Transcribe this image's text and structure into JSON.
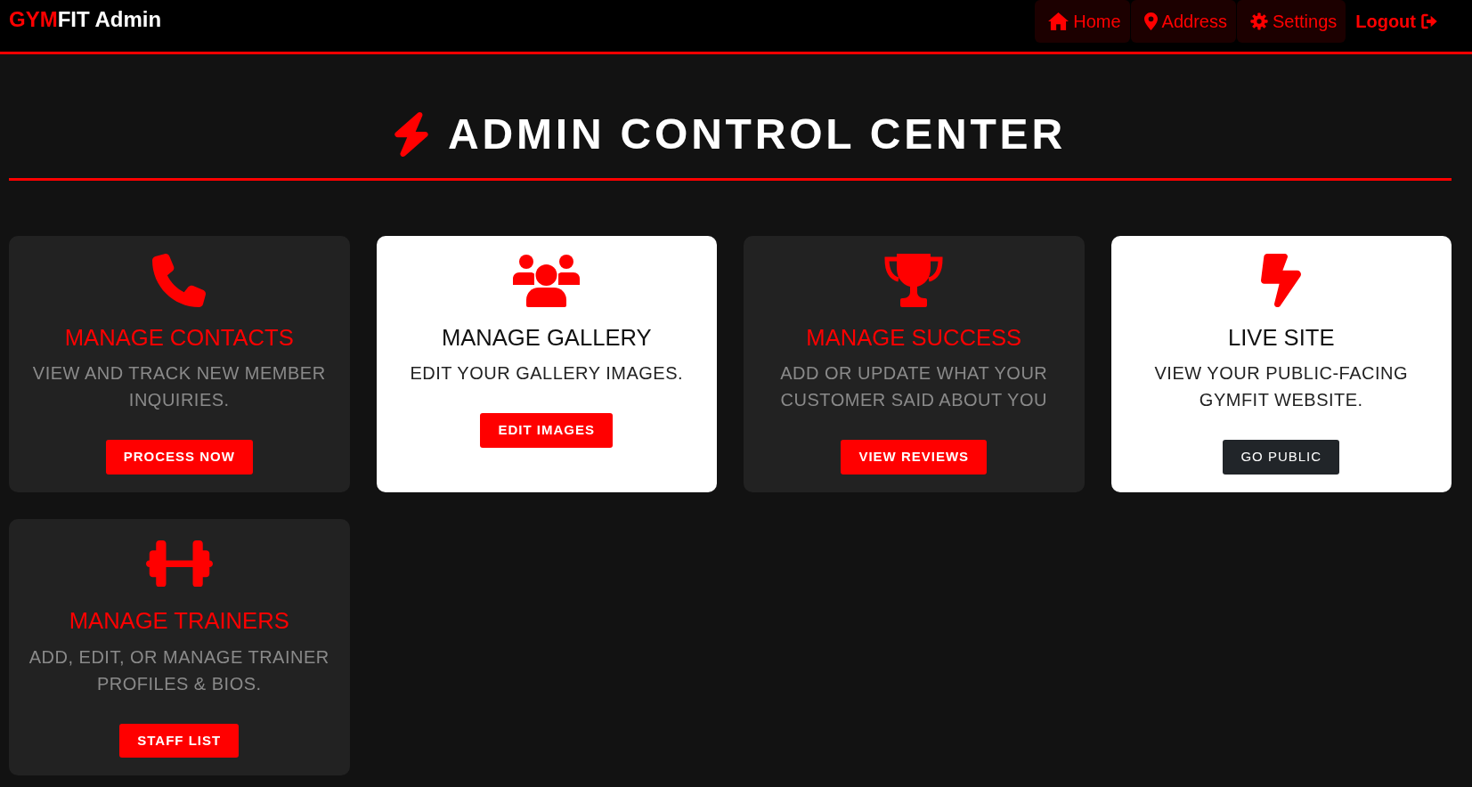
{
  "brand": {
    "accent": "GYM",
    "name": "FIT Admin"
  },
  "nav_links": [
    {
      "label": "Home",
      "kind": "tab"
    },
    {
      "label": "Address",
      "kind": "tab"
    },
    {
      "label": "Settings",
      "kind": "tab"
    },
    {
      "label": "Logout",
      "kind": "logout"
    }
  ],
  "header": {
    "title": "ADMIN CONTROL CENTER"
  },
  "cards": [
    {
      "kind": "dark",
      "title": "MANAGE CONTACTS",
      "description": "VIEW AND TRACK NEW MEMBER INQUIRIES.",
      "button": {
        "label": "PROCESS NOW",
        "kind": "primary"
      }
    },
    {
      "kind": "light",
      "title": "MANAGE GALLERY",
      "description": "EDIT YOUR GALLERY IMAGES.",
      "button": {
        "label": "EDIT IMAGES",
        "kind": "primary"
      }
    },
    {
      "kind": "dark",
      "title": "MANAGE SUCCESS",
      "description": "ADD OR UPDATE WHAT YOUR CUSTOMER SAID ABOUT YOU",
      "button": {
        "label": "VIEW REVIEWS",
        "kind": "primary"
      }
    },
    {
      "kind": "light",
      "title": "LIVE SITE",
      "description": "VIEW YOUR PUBLIC-FACING GYMFIT WEBSITE.",
      "button": {
        "label": "GO PUBLIC",
        "kind": "secondary"
      }
    },
    {
      "kind": "dark",
      "title": "MANAGE TRAINERS",
      "description": "ADD, EDIT, OR MANAGE TRAINER PROFILES & BIOS.",
      "button": {
        "label": "STAFF LIST",
        "kind": "primary"
      }
    }
  ]
}
